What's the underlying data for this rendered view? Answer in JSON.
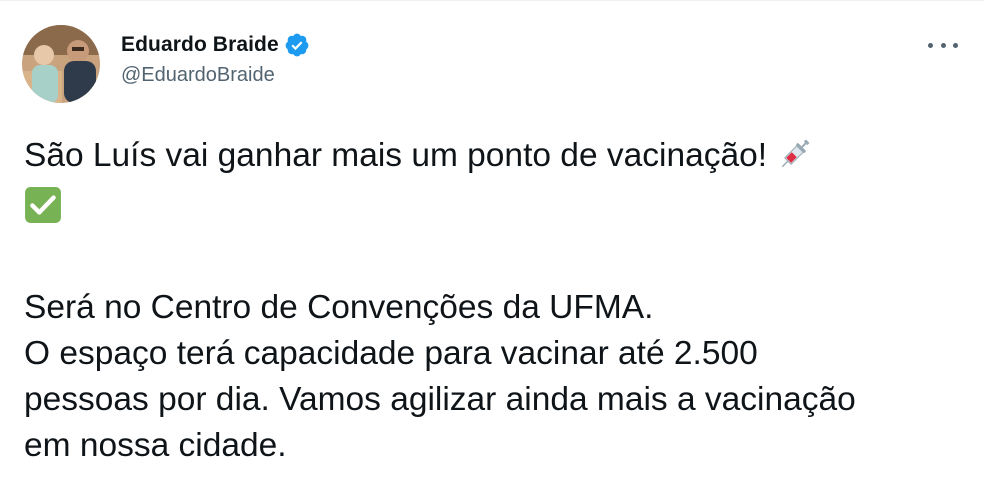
{
  "tweet": {
    "author": {
      "display_name": "Eduardo Braide",
      "handle": "@EduardoBraide",
      "verified": true,
      "avatar_icon": "profile-photo-avatar"
    },
    "more_icon": "more-options-icon",
    "text": {
      "line1": "São Luís vai ganhar mais um ponto de vacinação!",
      "emoji1": "syringe-icon",
      "emoji2": "check-mark-button-icon",
      "paragraph2": [
        "Será no Centro de Convenções da UFMA.",
        "O espaço terá capacidade para vacinar até 2.500",
        "pessoas por dia. Vamos agilizar ainda mais a vacinação",
        "em nossa cidade."
      ]
    },
    "colors": {
      "verified_badge": "#1d9bf0",
      "handle_text": "#536471",
      "check_emoji": "#77b255"
    }
  }
}
